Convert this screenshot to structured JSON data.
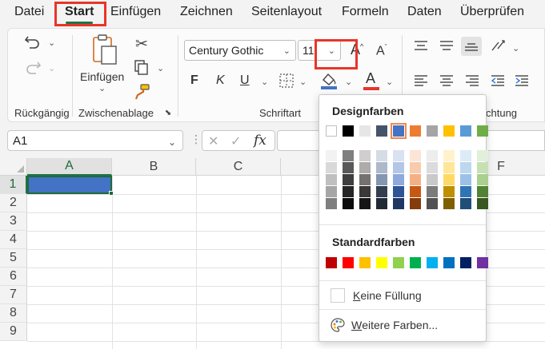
{
  "menu": {
    "items": [
      "Datei",
      "Start",
      "Einfügen",
      "Zeichnen",
      "Seitenlayout",
      "Formeln",
      "Daten",
      "Überprüfen"
    ],
    "active": "Start"
  },
  "ribbon": {
    "groups": {
      "undo": "Rückgängig",
      "clipboard": "Zwischenablage",
      "font": "Schriftart",
      "alignment_clipped": "chtung"
    },
    "paste_label": "Einfügen",
    "font_name": "Century Gothic",
    "font_size": "11",
    "bold_label": "F",
    "italic_label": "K",
    "underline_label": "U",
    "grow_label": "A",
    "shrink_label": "A",
    "font_color_label": "A",
    "fill_color": "#4472c4",
    "font_color": "#e8352a"
  },
  "namebox": {
    "value": "A1"
  },
  "formula": {
    "fx": "fx"
  },
  "grid": {
    "columns": [
      "A",
      "B",
      "C",
      "F"
    ],
    "rows": [
      "1",
      "2",
      "3",
      "4",
      "5",
      "6",
      "7",
      "8",
      "9"
    ],
    "selected_cell": "A1",
    "selected_fill": "#4472c4"
  },
  "fill_dropdown": {
    "design_heading": "Designfarben",
    "standard_heading": "Standardfarben",
    "theme_colors": [
      "#ffffff",
      "#000000",
      "#e7e6e6",
      "#44546a",
      "#4472c4",
      "#ed7d31",
      "#a5a5a5",
      "#ffc000",
      "#5b9bd5",
      "#70ad47"
    ],
    "selected_theme_index": 4,
    "shades": [
      [
        "#f2f2f2",
        "#d9d9d9",
        "#bfbfbf",
        "#a6a6a6",
        "#7f7f7f"
      ],
      [
        "#7f7f7f",
        "#595959",
        "#3f3f3f",
        "#262626",
        "#0d0d0d"
      ],
      [
        "#d0cece",
        "#aeabab",
        "#757171",
        "#3a3838",
        "#171616"
      ],
      [
        "#d6dce4",
        "#adb9ca",
        "#8497b0",
        "#333f4f",
        "#222a35"
      ],
      [
        "#d9e1f2",
        "#b4c6e7",
        "#8ea9db",
        "#2f5496",
        "#203764"
      ],
      [
        "#fce4d6",
        "#f8cbad",
        "#f4b084",
        "#c65911",
        "#833c0b"
      ],
      [
        "#ededed",
        "#dbdbdb",
        "#c9c9c9",
        "#7b7b7b",
        "#525252"
      ],
      [
        "#fff2cc",
        "#ffe699",
        "#ffd966",
        "#bf8f00",
        "#7f6000"
      ],
      [
        "#ddebf7",
        "#bdd7ee",
        "#9bc2e6",
        "#2f75b5",
        "#1f4e78"
      ],
      [
        "#e2efda",
        "#c6e0b4",
        "#a9d08e",
        "#548235",
        "#375623"
      ]
    ],
    "standard_colors": [
      "#c00000",
      "#ff0000",
      "#ffc000",
      "#ffff00",
      "#92d050",
      "#00b050",
      "#00b0f0",
      "#0070c0",
      "#002060",
      "#7030a0"
    ],
    "no_fill_first": "K",
    "no_fill_rest": "eine Füllung",
    "more_first": "W",
    "more_rest": "eitere Farben..."
  }
}
